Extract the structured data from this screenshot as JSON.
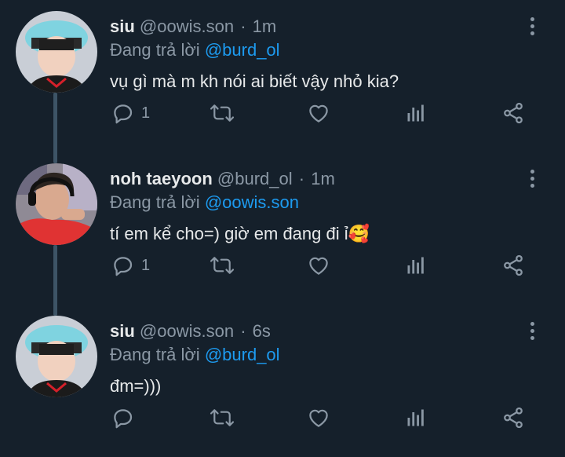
{
  "tweets": [
    {
      "name": "siu",
      "handle": "@oowis.son",
      "separator": "·",
      "time": "1m",
      "reply_prefix": "Đang trả lời",
      "reply_to": "@burd_ol",
      "text": "vụ gì mà m kh nói ai biết vậy nhỏ kia?",
      "reply_count": "1",
      "avatar_icon": "user-avatar-photo"
    },
    {
      "name": "noh taeyoon",
      "handle": "@burd_ol",
      "separator": "·",
      "time": "1m",
      "reply_prefix": "Đang trả lời",
      "reply_to": "@oowis.son",
      "text": "tí em kể cho=) giờ em đang đi ỉ",
      "emoji": "🥰",
      "reply_count": "1",
      "avatar_icon": "user-avatar-photo"
    },
    {
      "name": "siu",
      "handle": "@oowis.son",
      "separator": "·",
      "time": "6s",
      "reply_prefix": "Đang trả lời",
      "reply_to": "@burd_ol",
      "text": "đm=)))",
      "reply_count": "",
      "avatar_icon": "user-avatar-photo"
    }
  ],
  "colors": {
    "background": "#15202b",
    "text_primary": "#e7e9ea",
    "text_secondary": "#8b98a5",
    "link": "#1d9bf0",
    "thread_line": "#3d5466"
  },
  "icons": [
    "reply-icon",
    "retweet-icon",
    "like-icon",
    "analytics-icon",
    "share-icon",
    "more-options-icon"
  ]
}
